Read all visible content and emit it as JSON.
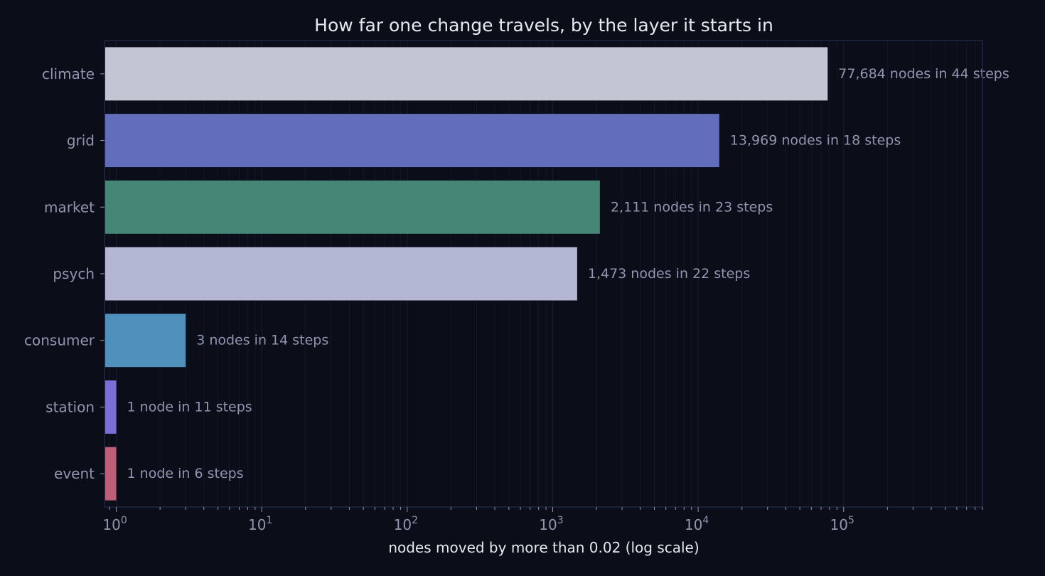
{
  "chart_data": {
    "type": "bar",
    "orientation": "horizontal",
    "title": "How far one change travels, by the layer it starts in",
    "xlabel": "nodes moved by more than 0.02 (log scale)",
    "ylabel": "",
    "x_scale": "log",
    "xlim": [
      0.83,
      900000
    ],
    "x_ticks": [
      {
        "value": 1,
        "base": "10",
        "exp": "0"
      },
      {
        "value": 10,
        "base": "10",
        "exp": "1"
      },
      {
        "value": 100,
        "base": "10",
        "exp": "2"
      },
      {
        "value": 1000,
        "base": "10",
        "exp": "3"
      },
      {
        "value": 10000,
        "base": "10",
        "exp": "4"
      },
      {
        "value": 100000,
        "base": "10",
        "exp": "5"
      }
    ],
    "grid": true,
    "legend": "none",
    "categories": [
      "climate",
      "grid",
      "market",
      "psych",
      "consumer",
      "station",
      "event"
    ],
    "values": [
      77684,
      13969,
      2111,
      1473,
      3,
      1,
      1
    ],
    "labels": [
      "77,684 nodes in 44 steps",
      "13,969 nodes in 18 steps",
      "2,111 nodes in 23 steps",
      "1,473 nodes in 22 steps",
      "3 nodes in 14 steps",
      "1 node in 11 steps",
      "1 node in 6 steps"
    ],
    "colors": [
      "#c3c5d2",
      "#626dbb",
      "#458675",
      "#b3b7d4",
      "#4f90bd",
      "#7a6fd6",
      "#be5e78"
    ]
  },
  "style": {
    "background": "#0b0e18",
    "frame": "#262b47",
    "text": "#e6e8f0",
    "muted": "#9095b0",
    "grid": "#161a2a"
  }
}
